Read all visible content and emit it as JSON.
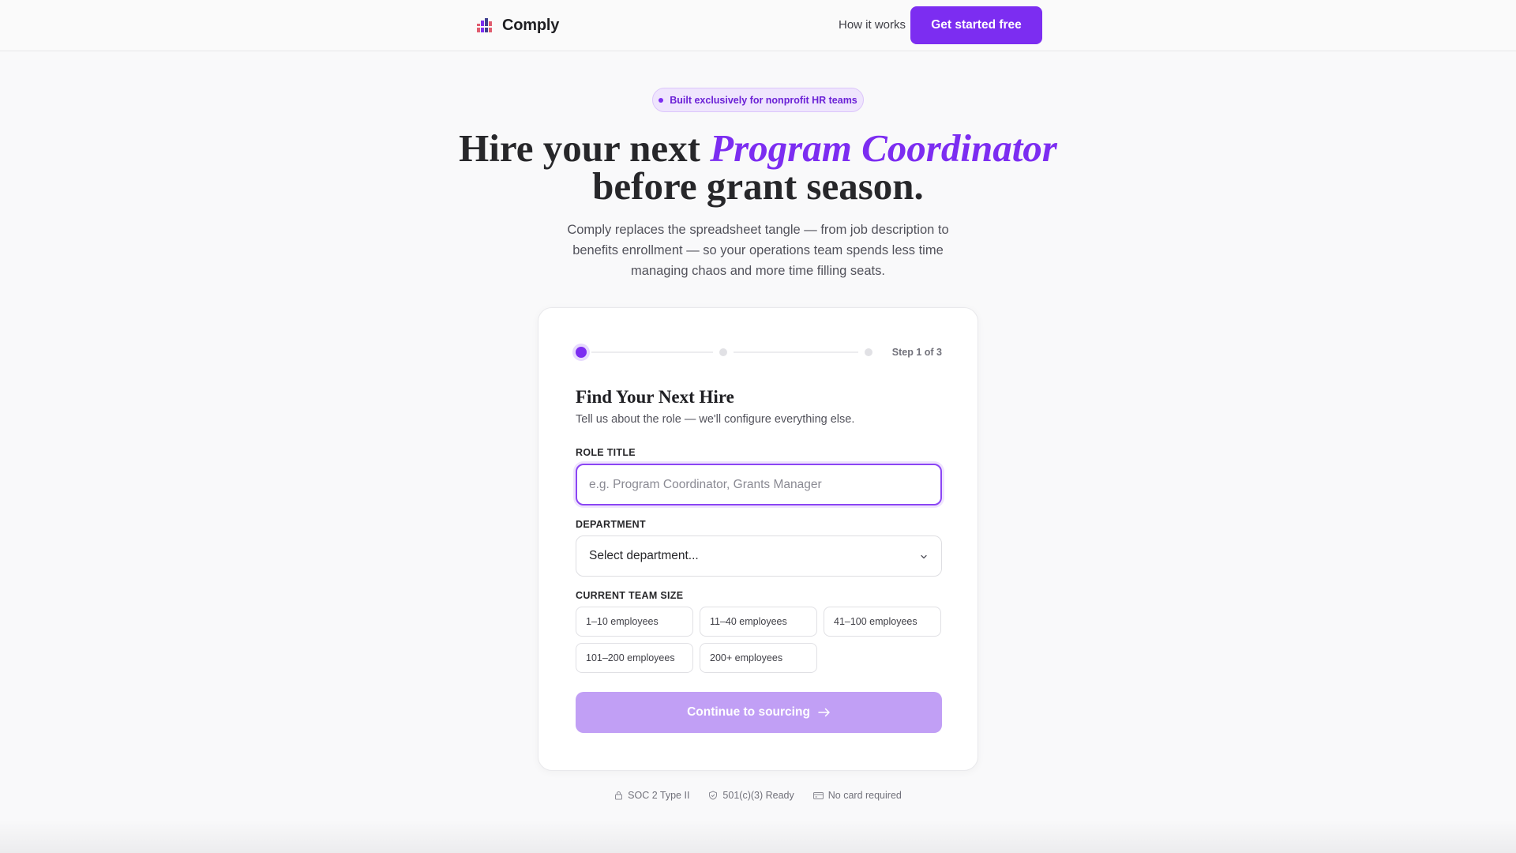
{
  "header": {
    "brand": "Comply",
    "nav_link": "How it works",
    "cta": "Get started free"
  },
  "hero": {
    "pill": "Built exclusively for nonprofit HR teams",
    "headline_part1": "Hire your next ",
    "headline_accent": "Program Coordinator",
    "headline_part2": " before grant season.",
    "subhead": "Comply replaces the spreadsheet tangle — from job description to benefits enrollment — so your operations team spends less time managing chaos and more time filling seats."
  },
  "form": {
    "step_label": "Step 1 of 3",
    "current_step": 1,
    "total_steps": 3,
    "title": "Find Your Next Hire",
    "subtitle": "Tell us about the role — we'll configure everything else.",
    "role_label": "ROLE TITLE",
    "role_value": "",
    "role_placeholder": "e.g. Program Coordinator, Grants Manager",
    "department_label": "DEPARTMENT",
    "department_value": "Select department...",
    "team_size_label": "CURRENT TEAM SIZE",
    "team_sizes": [
      "1–10 employees",
      "11–40 employees",
      "41–100 employees",
      "101–200 employees",
      "200+ employees"
    ],
    "continue_label": "Continue to sourcing"
  },
  "trust": {
    "items": [
      {
        "label": "SOC 2 Type II",
        "icon": "lock-icon"
      },
      {
        "label": "501(c)(3) Ready",
        "icon": "shield-check-icon"
      },
      {
        "label": "No card required",
        "icon": "credit-card-icon"
      }
    ]
  },
  "colors": {
    "accent": "#7c2df1",
    "accent_light": "#c19ff5",
    "background": "#f9f9fa",
    "text": "#27272a"
  }
}
